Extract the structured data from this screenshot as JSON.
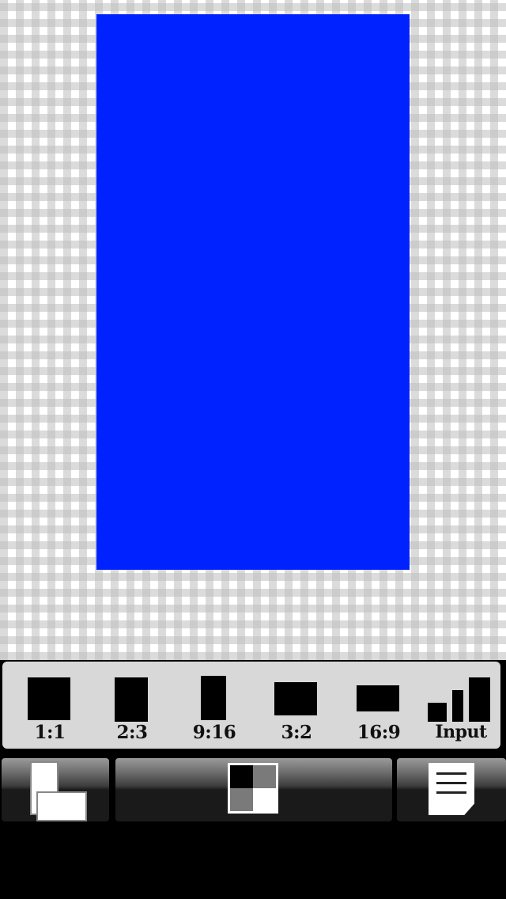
{
  "preview": {
    "fill_color": "#0022ff"
  },
  "ratio_panel": {
    "items": [
      {
        "label": "1:1",
        "icon": "square-ratio-icon"
      },
      {
        "label": "2:3",
        "icon": "portrait-ratio-icon"
      },
      {
        "label": "9:16",
        "icon": "tall-portrait-ratio-icon"
      },
      {
        "label": "3:2",
        "icon": "landscape-ratio-icon"
      },
      {
        "label": "16:9",
        "icon": "wide-landscape-ratio-icon"
      },
      {
        "label": "Input",
        "icon": "signal-bars-icon"
      }
    ]
  },
  "toolbar": {
    "left_icon": "pages-icon",
    "middle_icon": "checkerboard-icon",
    "right_icon": "document-icon"
  }
}
